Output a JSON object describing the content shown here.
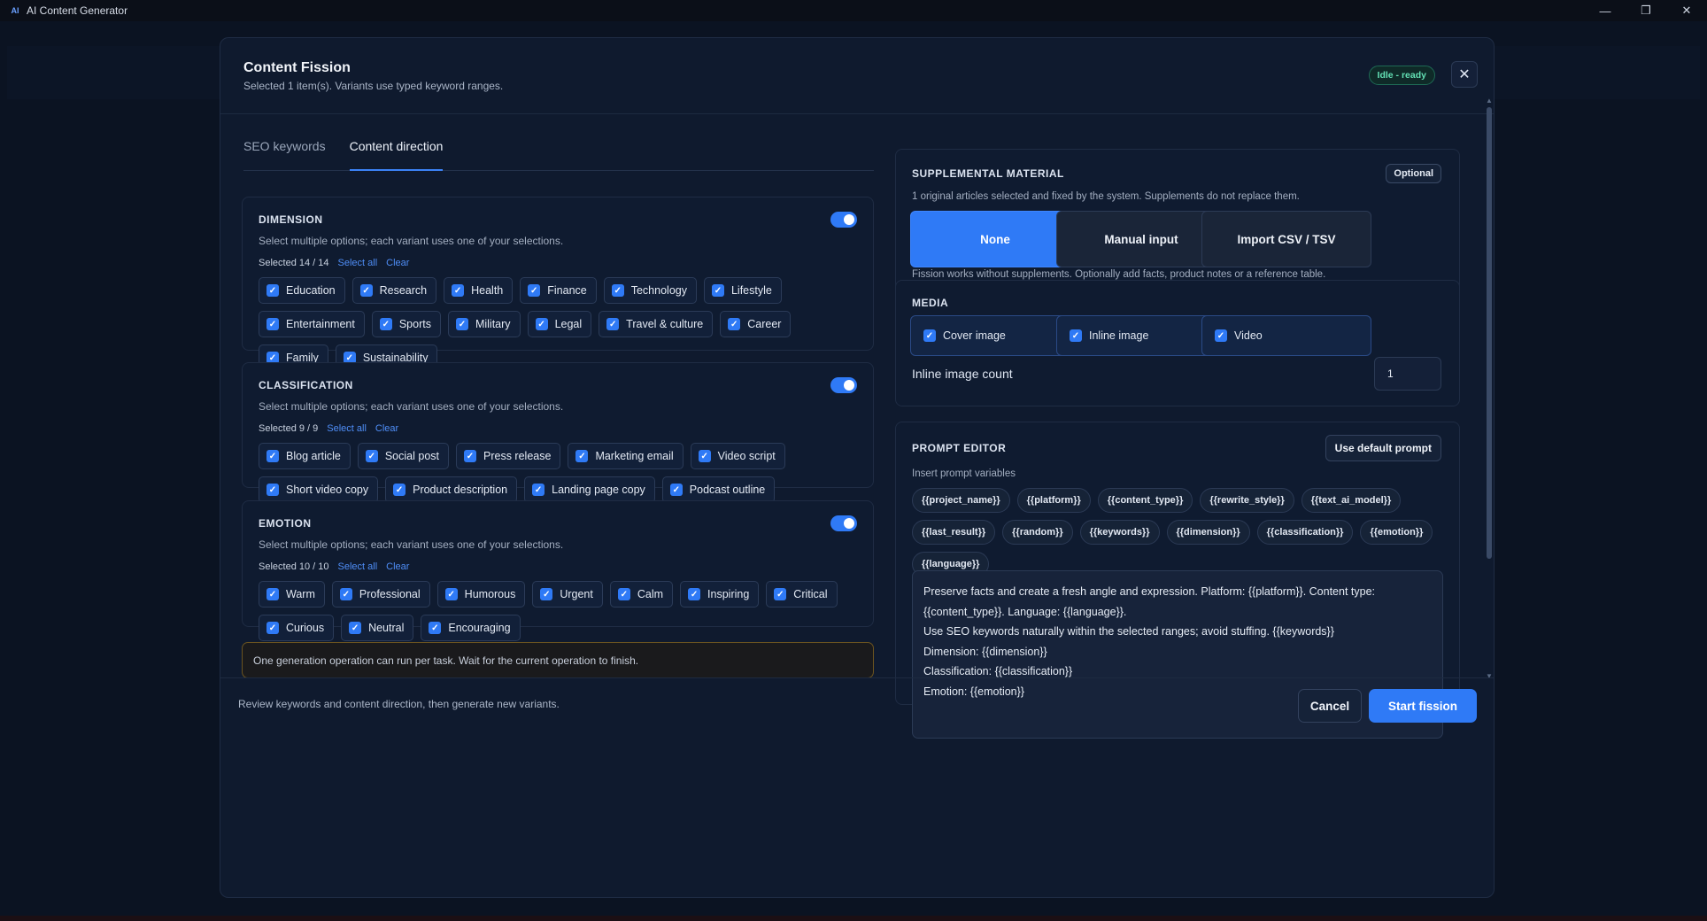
{
  "window": {
    "title": "AI Content Generator",
    "app_icon": "AI"
  },
  "modal": {
    "title": "Content Fission",
    "subtitle": "Selected 1 item(s). Variants use typed keyword ranges.",
    "status": "Idle - ready",
    "close_icon": "close-icon"
  },
  "tabs": [
    {
      "label": "SEO keywords",
      "active": false
    },
    {
      "label": "Content direction",
      "active": true
    }
  ],
  "sections": [
    {
      "title": "DIMENSION",
      "desc": "Select multiple options; each variant uses one of your selections.",
      "selected": "Selected 14 / 14",
      "select_all": "Select all",
      "clear": "Clear",
      "enabled": true,
      "options": [
        "Education",
        "Research",
        "Health",
        "Finance",
        "Technology",
        "Lifestyle",
        "Entertainment",
        "Sports",
        "Military",
        "Legal",
        "Travel & culture",
        "Career",
        "Family",
        "Sustainability"
      ]
    },
    {
      "title": "CLASSIFICATION",
      "desc": "Select multiple options; each variant uses one of your selections.",
      "selected": "Selected 9 / 9",
      "select_all": "Select all",
      "clear": "Clear",
      "enabled": true,
      "options": [
        "Blog article",
        "Social post",
        "Press release",
        "Marketing email",
        "Video script",
        "Short video copy",
        "Product description",
        "Landing page copy",
        "Podcast outline"
      ]
    },
    {
      "title": "EMOTION",
      "desc": "Select multiple options; each variant uses one of your selections.",
      "selected": "Selected 10 / 10",
      "select_all": "Select all",
      "clear": "Clear",
      "enabled": true,
      "options": [
        "Warm",
        "Professional",
        "Humorous",
        "Urgent",
        "Calm",
        "Inspiring",
        "Critical",
        "Curious",
        "Neutral",
        "Encouraging"
      ]
    }
  ],
  "warning": "One generation operation can run per task. Wait for the current operation to finish.",
  "supplemental": {
    "title": "SUPPLEMENTAL MATERIAL",
    "badge": "Optional",
    "desc": "1 original articles selected and fixed by the system. Supplements do not replace them.",
    "options": [
      "None",
      "Manual input",
      "Import CSV / TSV"
    ],
    "selected": "None",
    "note": "Fission works without supplements. Optionally add facts, product notes or a reference table."
  },
  "media": {
    "title": "MEDIA",
    "options": [
      "Cover image",
      "Inline image",
      "Video"
    ],
    "count_label": "Inline image count",
    "count_value": "1"
  },
  "prompt": {
    "title": "PROMPT EDITOR",
    "default_button": "Use default prompt",
    "vars_label": "Insert prompt variables",
    "variables": [
      "{{project_name}}",
      "{{platform}}",
      "{{content_type}}",
      "{{rewrite_style}}",
      "{{text_ai_model}}",
      "{{last_result}}",
      "{{random}}",
      "{{keywords}}",
      "{{dimension}}",
      "{{classification}}",
      "{{emotion}}",
      "{{language}}"
    ],
    "lines": [
      "Preserve facts and create a fresh angle and expression. Platform: {{platform}}. Content type: {{content_type}}. Language: {{language}}.",
      "Use SEO keywords naturally within the selected ranges; avoid stuffing. {{keywords}}",
      "Dimension: {{dimension}}",
      "Classification: {{classification}}",
      "Emotion: {{emotion}}"
    ]
  },
  "footer": {
    "note": "Review keywords and content direction, then generate new variants.",
    "cancel": "Cancel",
    "start": "Start fission"
  },
  "colors": {
    "accent": "#2f7af6",
    "success": "#63e0b4",
    "warning_border": "#6b5420"
  }
}
